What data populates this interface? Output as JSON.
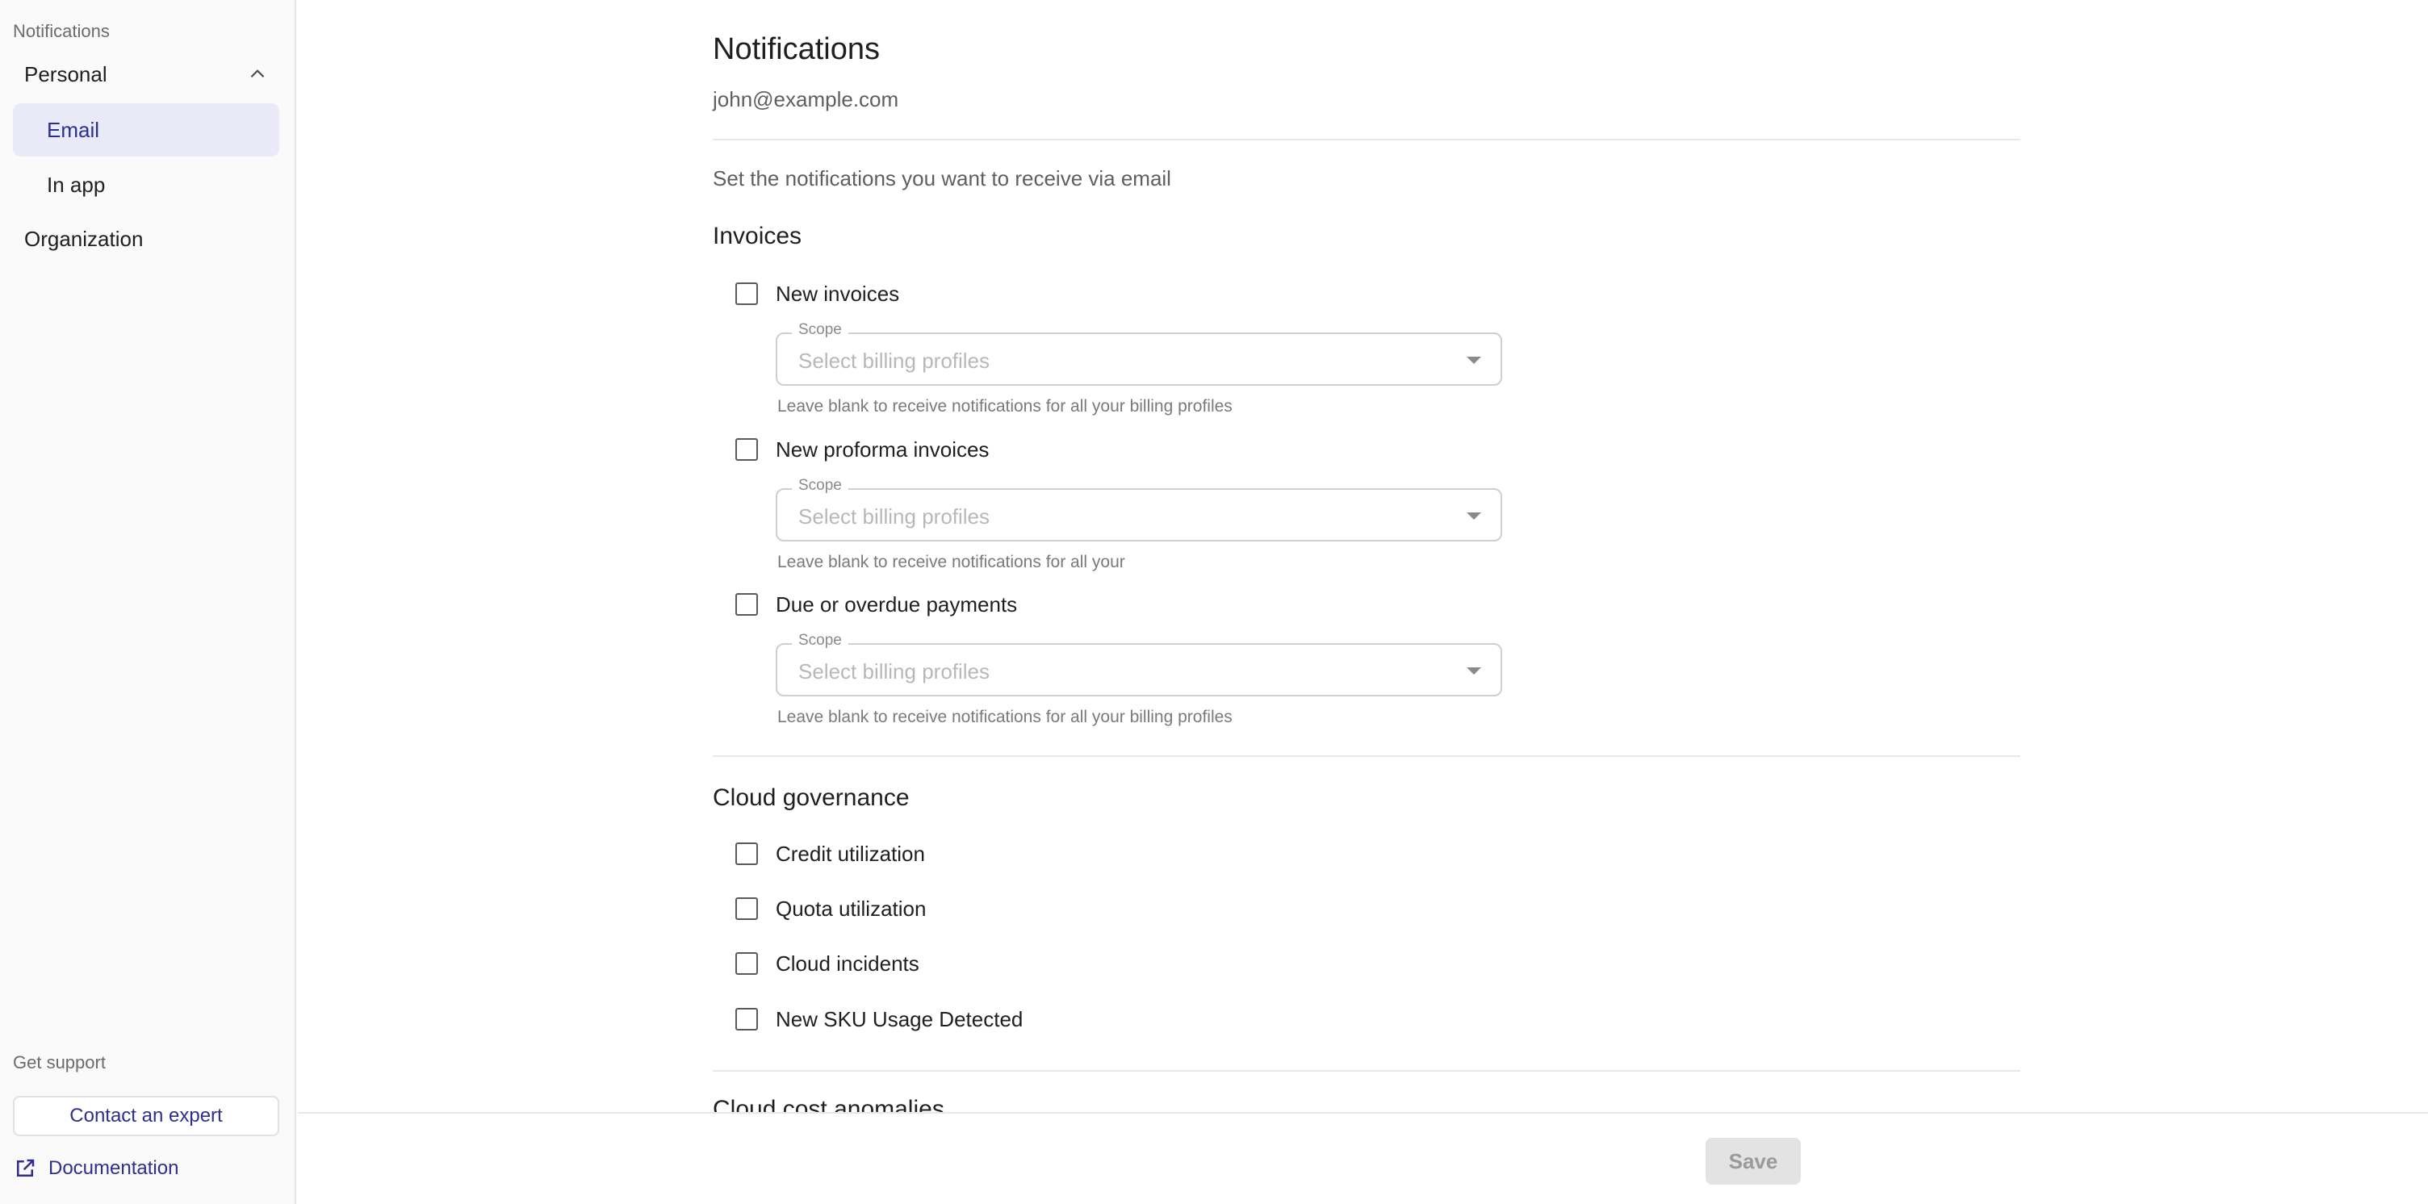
{
  "sidebar": {
    "section_label": "Notifications",
    "personal": {
      "label": "Personal",
      "items": [
        {
          "label": "Email",
          "active": true
        },
        {
          "label": "In app",
          "active": false
        }
      ]
    },
    "organization_label": "Organization",
    "support": {
      "label": "Get support",
      "contact_label": "Contact an expert",
      "documentation_label": "Documentation"
    }
  },
  "main": {
    "title": "Notifications",
    "email": "john@example.com",
    "intro": "Set the notifications you want to receive via email",
    "sections": [
      {
        "title": "Invoices",
        "items": [
          {
            "label": "New invoices",
            "checked": false,
            "scope_label": "Scope",
            "scope_placeholder": "Select billing profiles",
            "help": "Leave blank to receive notifications for all your billing profiles"
          },
          {
            "label": "New proforma invoices",
            "checked": false,
            "scope_label": "Scope",
            "scope_placeholder": "Select billing profiles",
            "help": "Leave blank to receive notifications for all your"
          },
          {
            "label": "Due or overdue payments",
            "checked": false,
            "scope_label": "Scope",
            "scope_placeholder": "Select billing profiles",
            "help": "Leave blank to receive notifications for all your billing profiles"
          }
        ]
      },
      {
        "title": "Cloud governance",
        "items": [
          {
            "label": "Credit utilization",
            "checked": false
          },
          {
            "label": "Quota utilization",
            "checked": false
          },
          {
            "label": "Cloud incidents",
            "checked": false
          },
          {
            "label": "New SKU Usage Detected",
            "checked": false
          }
        ]
      },
      {
        "title": "Cloud cost anomalies"
      }
    ]
  },
  "footer": {
    "save_label": "Save"
  },
  "colors": {
    "accent": "#2d2f8f",
    "active_bg": "#e9e9f7",
    "disabled_bg": "#e3e3e3"
  }
}
